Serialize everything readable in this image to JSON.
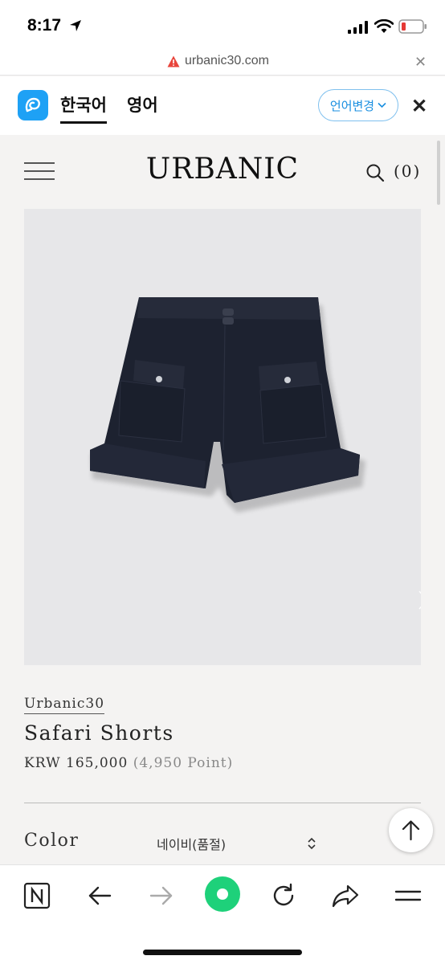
{
  "status_bar": {
    "time": "8:17"
  },
  "url_bar": {
    "url": "urbanic30.com"
  },
  "translate_bar": {
    "source_lang": "한국어",
    "target_lang": "영어",
    "change_language": "언어변경"
  },
  "site": {
    "logo": "URBANIC",
    "cart_count": "(0)"
  },
  "product": {
    "brand": "Urbanic30",
    "name": "Safari Shorts",
    "price": "KRW 165,000",
    "points": "(4,950 Point)",
    "color_label": "Color",
    "color_value": "네이비(품절)",
    "image_color": "#1d2230"
  },
  "icons": {
    "url_warning": "warning-icon",
    "translate": "papago-icon",
    "toolbar": [
      "naver-n-icon",
      "back-arrow-icon",
      "forward-arrow-icon",
      "green-home-icon",
      "reload-icon",
      "share-icon",
      "menu-icon"
    ]
  },
  "colors": {
    "accent": "#1a8fe0",
    "green": "#1ed17a",
    "translate_icon": "#1ea1f5"
  }
}
